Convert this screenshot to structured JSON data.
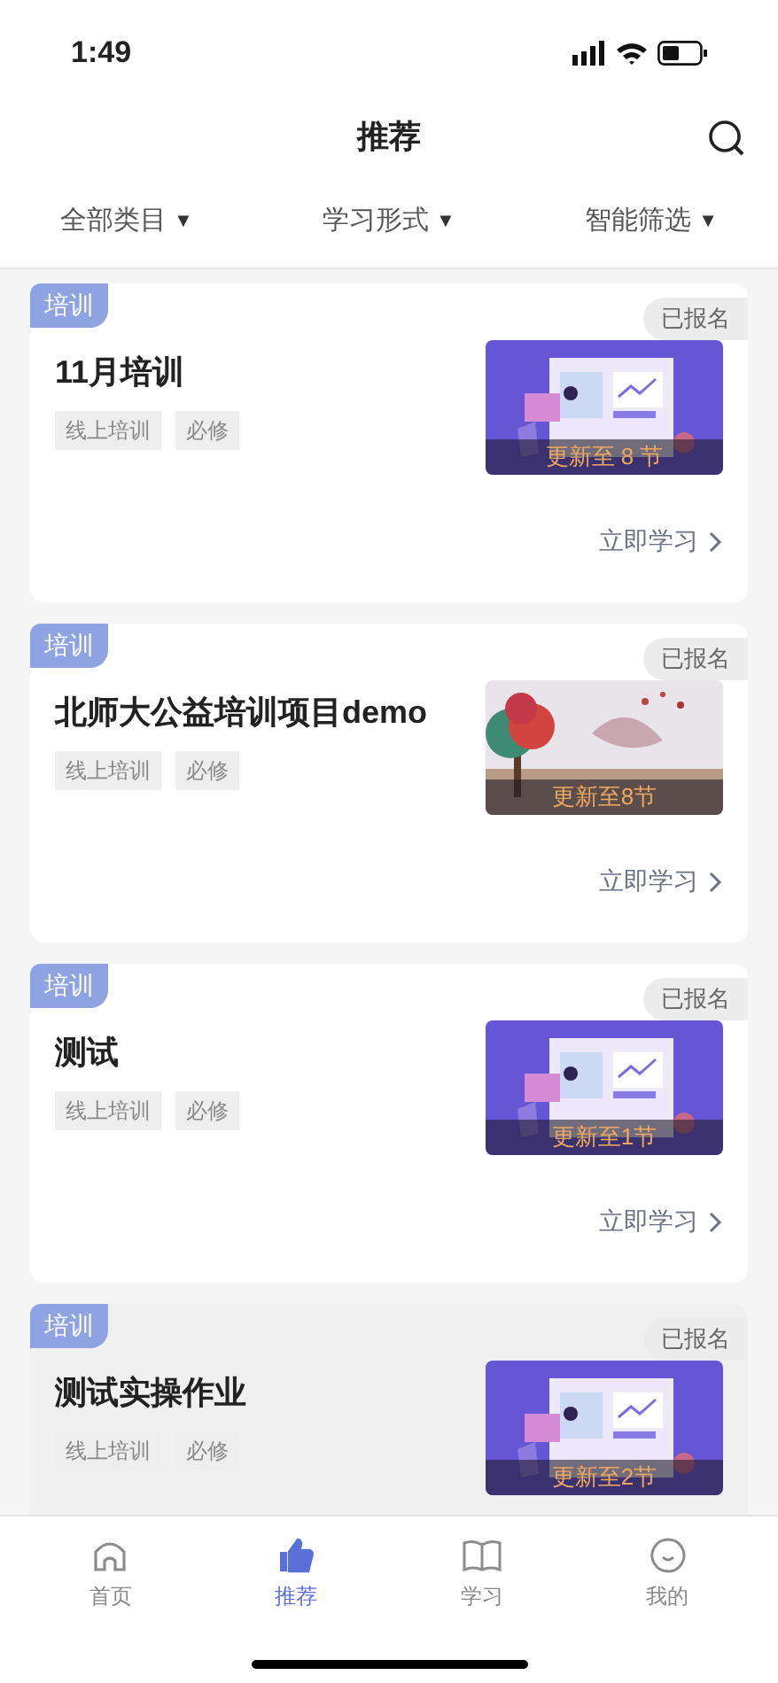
{
  "status_bar": {
    "time": "1:49"
  },
  "header": {
    "title": "推荐"
  },
  "filters": [
    {
      "label": "全部类目",
      "caret": "▼"
    },
    {
      "label": "学习形式",
      "caret": "▼"
    },
    {
      "label": "智能筛选",
      "caret": "▼"
    }
  ],
  "courses": [
    {
      "tag": "培训",
      "status": "已报名",
      "title": "11月培训",
      "chips": [
        "线上培训",
        "必修"
      ],
      "thumbnail": {
        "kind": "illustration",
        "overlay": "更新至 8 节"
      },
      "action": "立即学习",
      "pressed": false
    },
    {
      "tag": "培训",
      "status": "已报名",
      "title": "北师大公益培训项目demo",
      "chips": [
        "线上培训",
        "必修"
      ],
      "thumbnail": {
        "overlay": "更新至8节"
      },
      "action": "立即学习",
      "pressed": false
    },
    {
      "tag": "培训",
      "status": "已报名",
      "title": "测试",
      "chips": [
        "线上培训",
        "必修"
      ],
      "thumbnail": {
        "kind": "illustration",
        "overlay": "更新至1节"
      },
      "action": "立即学习",
      "pressed": false
    },
    {
      "tag": "培训",
      "status": "已报名",
      "title": "测试实操作业",
      "chips": [
        "线上培训",
        "必修"
      ],
      "thumbnail": {
        "kind": "illustration",
        "overlay": "更新至2节"
      },
      "pressed": true
    }
  ],
  "tab_bar": [
    {
      "label": "首页",
      "kind": "home",
      "selected": false
    },
    {
      "label": "推荐",
      "kind": "thumb",
      "selected": true
    },
    {
      "label": "学习",
      "kind": "book",
      "selected": false
    },
    {
      "label": "我的",
      "kind": "smile",
      "selected": false
    }
  ]
}
